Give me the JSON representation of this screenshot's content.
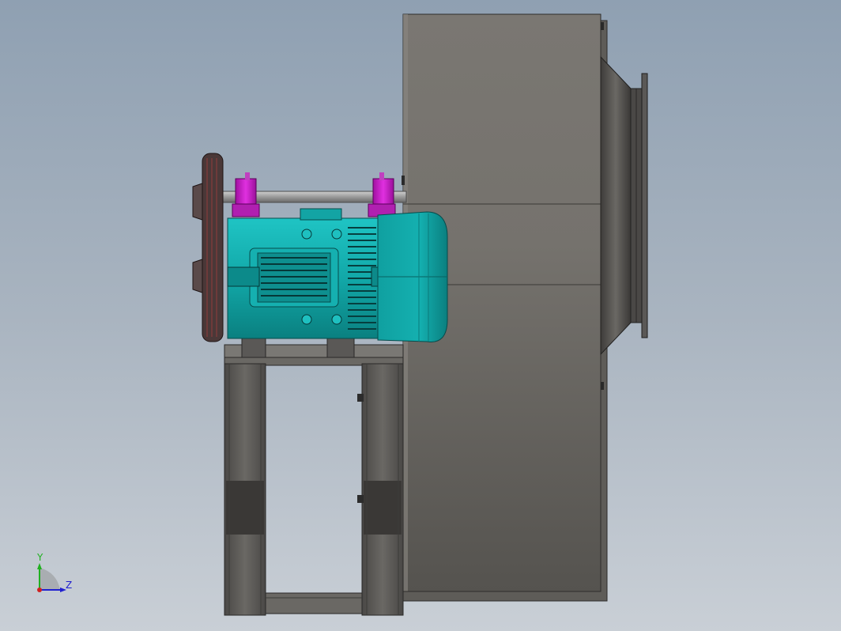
{
  "viewport": {
    "background_top": "#8fa0b2",
    "background_bottom": "#c9cfd6"
  },
  "model": {
    "housing_color": "#6c6a66",
    "motor_color": "#13a8a8",
    "bearing_color": "#cc22cc",
    "frame_color": "#5a5856",
    "pulley_color": "#4a3838"
  },
  "triad": {
    "y_label": "Y",
    "z_label": "Z",
    "y_color": "#20b020",
    "z_color": "#2020d0",
    "x_color": "#d02020"
  }
}
